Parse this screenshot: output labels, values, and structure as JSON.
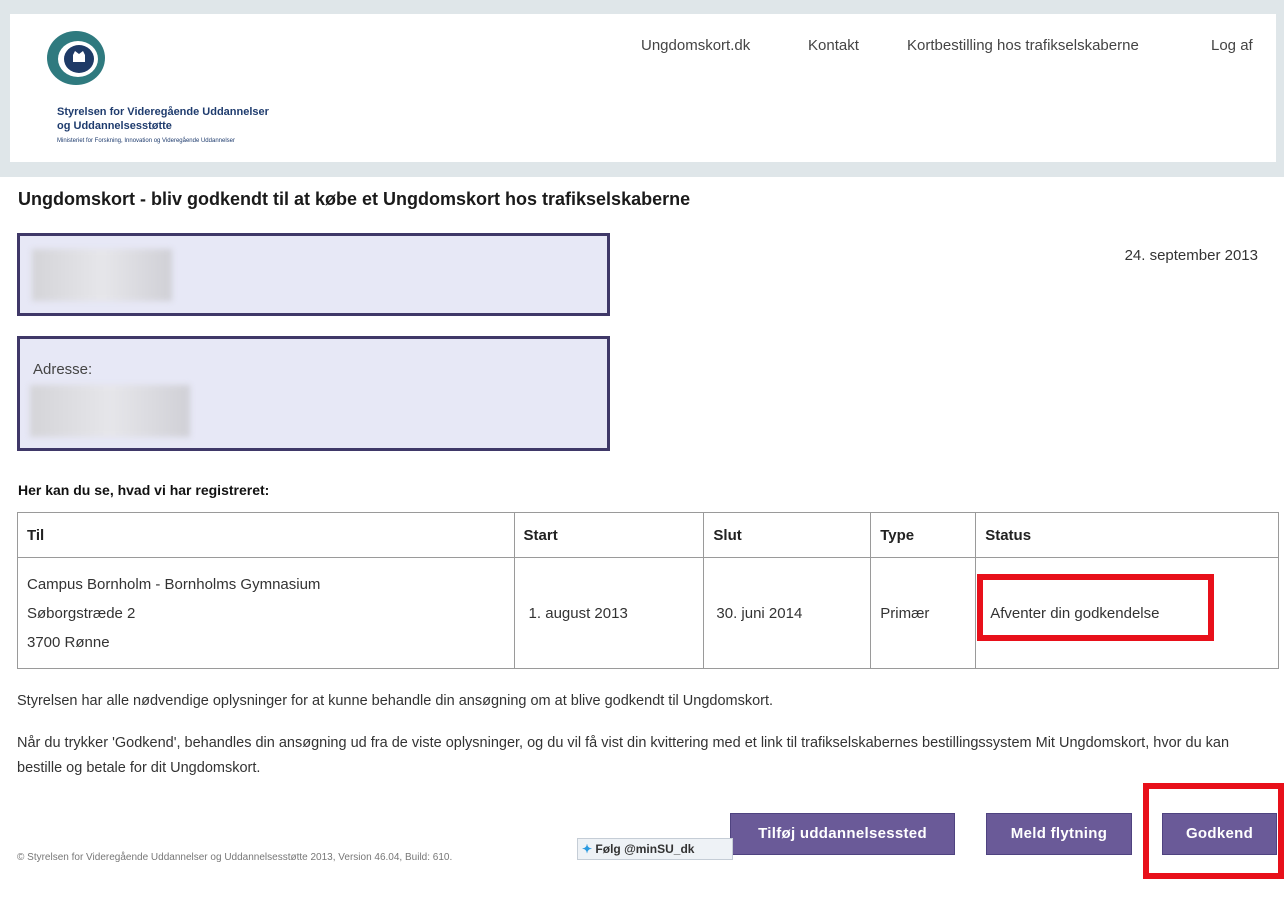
{
  "header": {
    "org_line_1": "Styrelsen for Videregående Uddannelser",
    "org_line_2": "og Uddannelsesstøtte",
    "org_line_3": "Ministeriet for Forskning, Innovation og Videregående Uddannelser",
    "nav": [
      {
        "label": "Ungdomskort.dk"
      },
      {
        "label": "Kontakt"
      },
      {
        "label": "Kortbestilling hos trafikselskaberne"
      },
      {
        "label": "Log af"
      }
    ]
  },
  "page": {
    "title": "Ungdomskort - bliv godkendt til at købe et Ungdomskort hos trafikselskaberne",
    "date": "24. september 2013",
    "address_label": "Adresse:",
    "section_title": "Her kan du se, hvad vi har registreret:"
  },
  "table": {
    "headers": [
      "Til",
      "Start",
      "Slut",
      "Type",
      "Status"
    ],
    "row": {
      "til": [
        "Campus Bornholm - Bornholms Gymnasium",
        "Søborgstræde 2",
        "3700 Rønne"
      ],
      "start": "1. august 2013",
      "slut": "30. juni 2014",
      "type": "Primær",
      "status": "Afventer din godkendelse"
    }
  },
  "text": {
    "p1": "Styrelsen har alle nødvendige oplysninger for at kunne behandle din ansøgning om at blive godkendt til Ungdomskort.",
    "p2": "Når du trykker 'Godkend', behandles din ansøgning ud fra de viste oplysninger, og du vil få vist din kvittering med et link til trafikselskabernes bestillingssystem Mit Ungdomskort, hvor du kan bestille og betale for dit Ungdomskort."
  },
  "buttons": {
    "add_education": "Tilføj uddannelsessted",
    "report_move": "Meld flytning",
    "approve": "Godkend"
  },
  "footer": {
    "text": "© Styrelsen for Videregående Uddannelser og Uddannelsesstøtte 2013, Version 46.04, Build: 610.",
    "follow": "Følg @minSU_dk"
  },
  "colors": {
    "button": "#6a5a98",
    "box_border": "#3f3868",
    "box_fill": "#e7e8f6",
    "highlight": "#e8101a"
  }
}
